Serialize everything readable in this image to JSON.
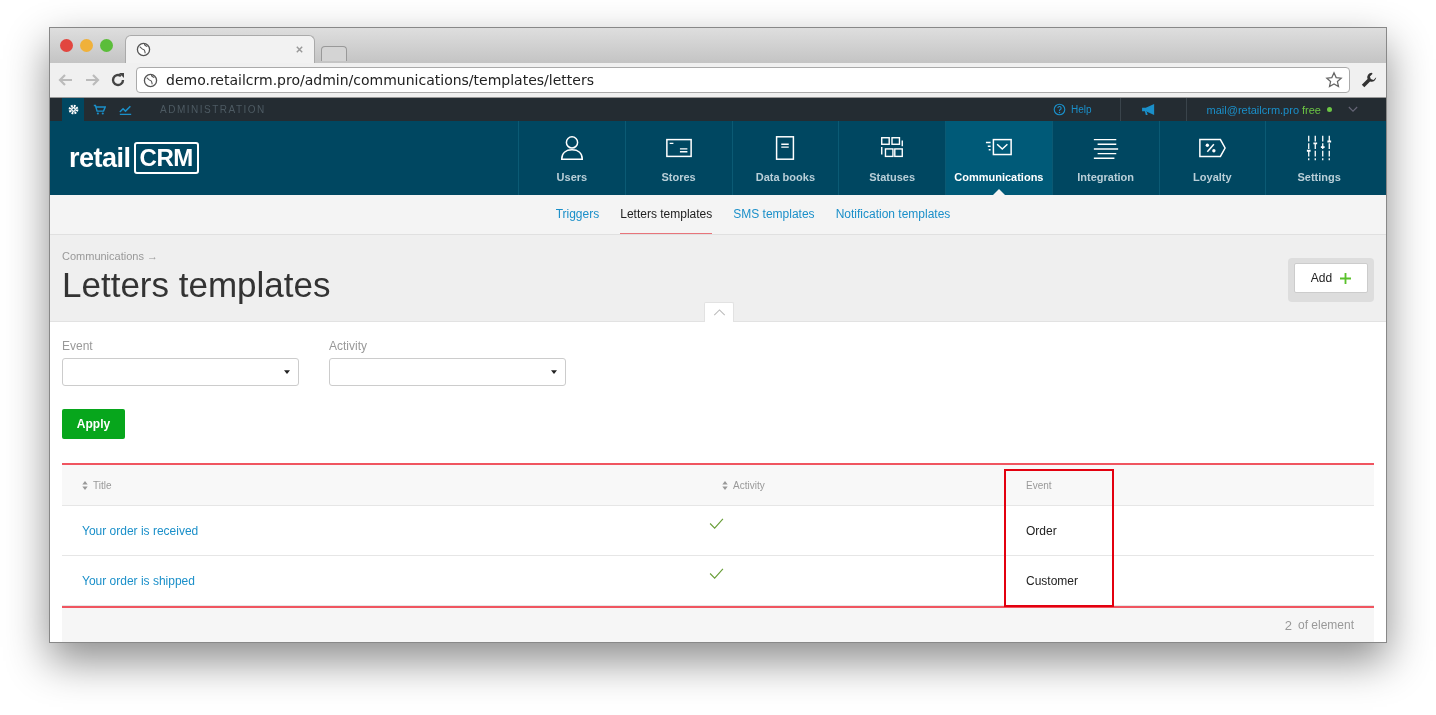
{
  "browser": {
    "url": "demo.retailcrm.pro/admin/communications/templates/letters"
  },
  "topbar": {
    "apps": [
      {
        "kind": "settings",
        "selected": true
      },
      {
        "kind": "cart",
        "selected": false
      },
      {
        "kind": "chart",
        "selected": false
      }
    ],
    "section": "ADMINISTRATION",
    "help": "Help",
    "account": "mail@retailcrm.pro",
    "plan": "free"
  },
  "logo": {
    "part_1": "retail",
    "part_2": "CRM"
  },
  "nav": [
    {
      "label": "Users",
      "kind": "user",
      "selected": false
    },
    {
      "label": "Stores",
      "kind": "store",
      "selected": false
    },
    {
      "label": "Data books",
      "kind": "book",
      "selected": false
    },
    {
      "label": "Statuses",
      "kind": "statuses",
      "selected": false
    },
    {
      "label": "Communications",
      "kind": "mail",
      "selected": true
    },
    {
      "label": "Integration",
      "kind": "lines",
      "selected": false
    },
    {
      "label": "Loyalty",
      "kind": "percent",
      "selected": false
    },
    {
      "label": "Settings",
      "kind": "sliders",
      "selected": false
    }
  ],
  "subtabs": [
    {
      "label": "Triggers",
      "selected": false
    },
    {
      "label": "Letters templates",
      "selected": true
    },
    {
      "label": "SMS templates",
      "selected": false
    },
    {
      "label": "Notification templates",
      "selected": false
    }
  ],
  "breadcrumb": "Communications →",
  "title": "Letters templates",
  "add_button": "Add",
  "filters": [
    {
      "label": "Event"
    },
    {
      "label": "Activity"
    }
  ],
  "apply_button": "Apply",
  "table": {
    "columns": [
      {
        "label": "Title",
        "sortable": true,
        "highlighted": false
      },
      {
        "label": "Activity",
        "sortable": true,
        "highlighted": false
      },
      {
        "label": "Event",
        "sortable": false,
        "highlighted": true
      }
    ],
    "rows": [
      {
        "title": "Your order is received",
        "active": true,
        "event": "Order"
      },
      {
        "title": "Your order is shipped",
        "active": true,
        "event": "Customer"
      }
    ]
  },
  "footer": {
    "count": "2",
    "label": "of element"
  }
}
